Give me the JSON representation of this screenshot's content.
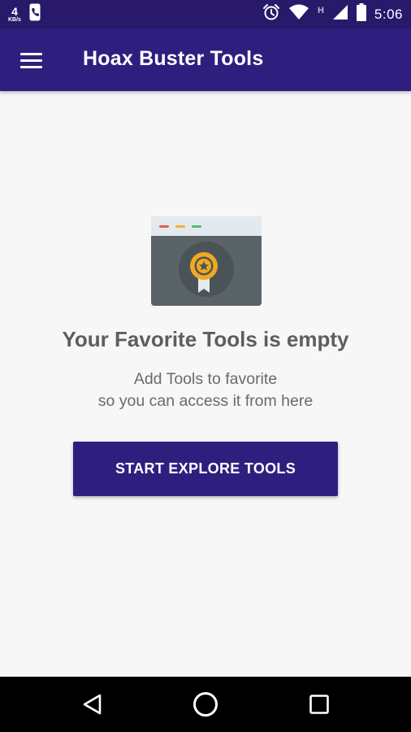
{
  "status_bar": {
    "net_speed_value": "4",
    "net_speed_unit": "KB/s",
    "signal_badge": "H",
    "time": "5:06",
    "icons": [
      "phone-icon",
      "alarm-icon",
      "wifi-icon",
      "cellular-signal-icon",
      "battery-icon"
    ]
  },
  "app_bar": {
    "title": "Hoax Buster Tools",
    "menu_icon": "hamburger-menu-icon"
  },
  "empty_state": {
    "title": "Your Favorite Tools is empty",
    "description_line1": "Add Tools to favorite",
    "description_line2": "so you can access it from here",
    "button_label": "START EXPLORE TOOLS",
    "illustration": "browser-award-badge-illustration"
  },
  "nav_bar": {
    "icons": [
      "back-icon",
      "home-icon",
      "recents-icon"
    ]
  },
  "colors": {
    "primary": "#2e1f7f",
    "status_bar": "#28196a",
    "background": "#f7f7f8",
    "badge_gold": "#f2a91f"
  }
}
